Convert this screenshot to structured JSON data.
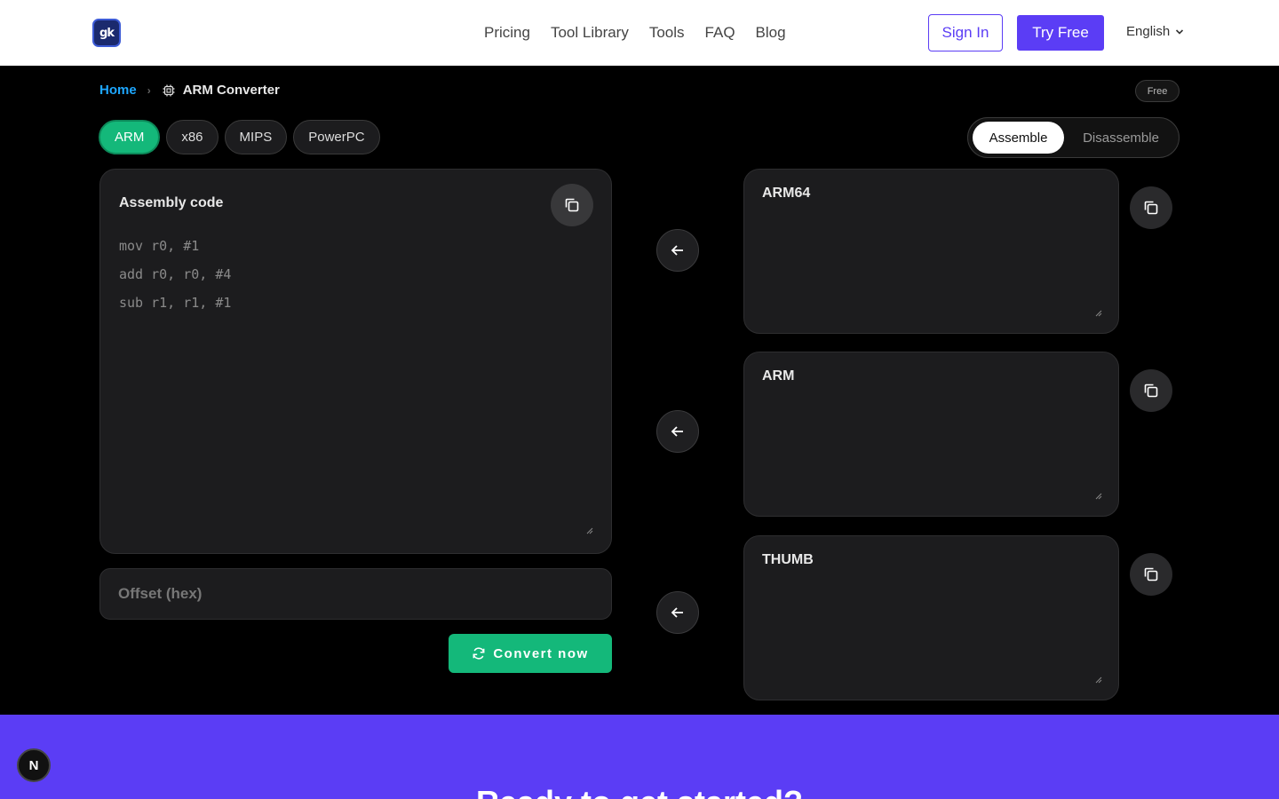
{
  "header": {
    "logo_text": "gk",
    "nav": [
      "Pricing",
      "Tool Library",
      "Tools",
      "FAQ",
      "Blog"
    ],
    "sign_in": "Sign In",
    "try_free": "Try Free",
    "language": "English"
  },
  "breadcrumb": {
    "home": "Home",
    "separator": "›",
    "current": "ARM Converter"
  },
  "badge": "Free",
  "arch_tabs": [
    "ARM",
    "x86",
    "MIPS",
    "PowerPC"
  ],
  "active_arch": "ARM",
  "mode": {
    "assemble": "Assemble",
    "disassemble": "Disassemble",
    "active": "Assemble"
  },
  "input": {
    "title": "Assembly code",
    "placeholder_lines": [
      "mov r0, #1",
      "add r0, r0, #4",
      "sub r1, r1, #1"
    ],
    "offset_placeholder": "Offset (hex)",
    "convert_label": "Convert now"
  },
  "outputs": [
    {
      "title": "ARM64"
    },
    {
      "title": "ARM"
    },
    {
      "title": "THUMB"
    }
  ],
  "cta": {
    "title": "Ready to get started?"
  },
  "floating_badge": "N",
  "colors": {
    "accent_green": "#14b87a",
    "brand_purple": "#5b3df5",
    "link_blue": "#1ea7ff"
  }
}
